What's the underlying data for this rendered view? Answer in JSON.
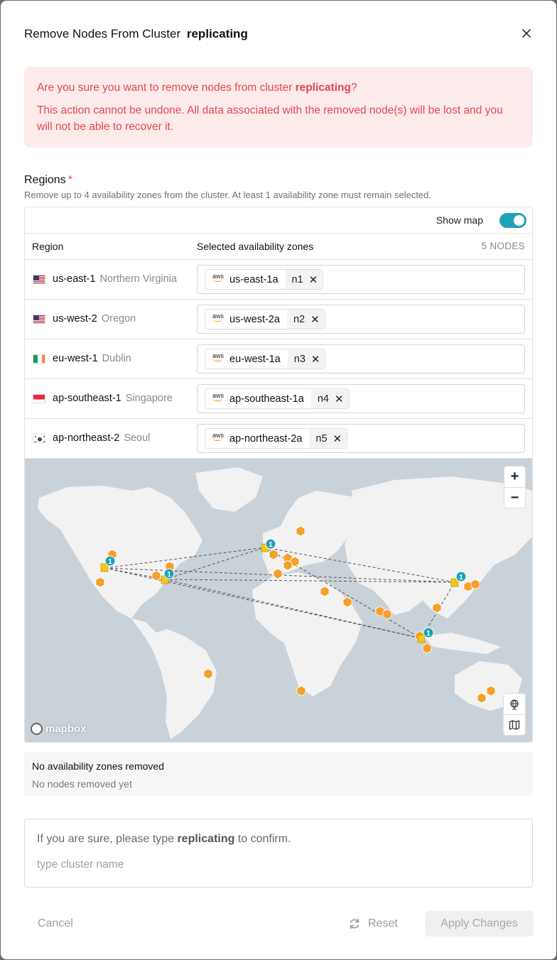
{
  "dialog": {
    "title_prefix": "Remove Nodes From Cluster",
    "cluster_name": "replicating"
  },
  "alert": {
    "question_prefix": "Are you sure you want to remove nodes from cluster",
    "cluster_name": "replicating",
    "question_suffix": "?",
    "warning": "This action cannot be undone. All data associated with the removed node(s) will be lost and you will not be able to recover it."
  },
  "regions": {
    "label": "Regions",
    "required_mark": "*",
    "hint": "Remove up to 4 availability zones from the cluster. At least 1 availability zone must remain selected.",
    "show_map_label": "Show map",
    "show_map_on": true,
    "col_region": "Region",
    "col_zones": "Selected availability zones",
    "node_count": "5 NODES",
    "rows": [
      {
        "region": "us-east-1",
        "city": "Northern Virginia",
        "flag": "us",
        "zone": "us-east-1a",
        "node": "n1",
        "provider": "aws"
      },
      {
        "region": "us-west-2",
        "city": "Oregon",
        "flag": "us",
        "zone": "us-west-2a",
        "node": "n2",
        "provider": "aws"
      },
      {
        "region": "eu-west-1",
        "city": "Dublin",
        "flag": "ie",
        "zone": "eu-west-1a",
        "node": "n3",
        "provider": "aws"
      },
      {
        "region": "ap-southeast-1",
        "city": "Singapore",
        "flag": "sg",
        "zone": "ap-southeast-1a",
        "node": "n4",
        "provider": "aws"
      },
      {
        "region": "ap-northeast-2",
        "city": "Seoul",
        "flag": "kr",
        "zone": "ap-northeast-2a",
        "node": "n5",
        "provider": "aws"
      }
    ]
  },
  "map": {
    "zoom_in": "+",
    "zoom_out": "−",
    "attribution": "mapbox",
    "node_badge": "1"
  },
  "removed": {
    "title": "No availability zones removed",
    "subtitle": "No nodes removed yet"
  },
  "confirm": {
    "prompt_prefix": "If you are sure, please type",
    "cluster_name": "replicating",
    "prompt_suffix": "to confirm.",
    "placeholder": "type cluster name",
    "value": ""
  },
  "footer": {
    "cancel": "Cancel",
    "reset": "Reset",
    "apply": "Apply Changes"
  },
  "colors": {
    "accent": "#1fa2b8",
    "danger": "#e5484d",
    "danger_bg": "#fdebeb",
    "marker": "#f5a02a"
  }
}
